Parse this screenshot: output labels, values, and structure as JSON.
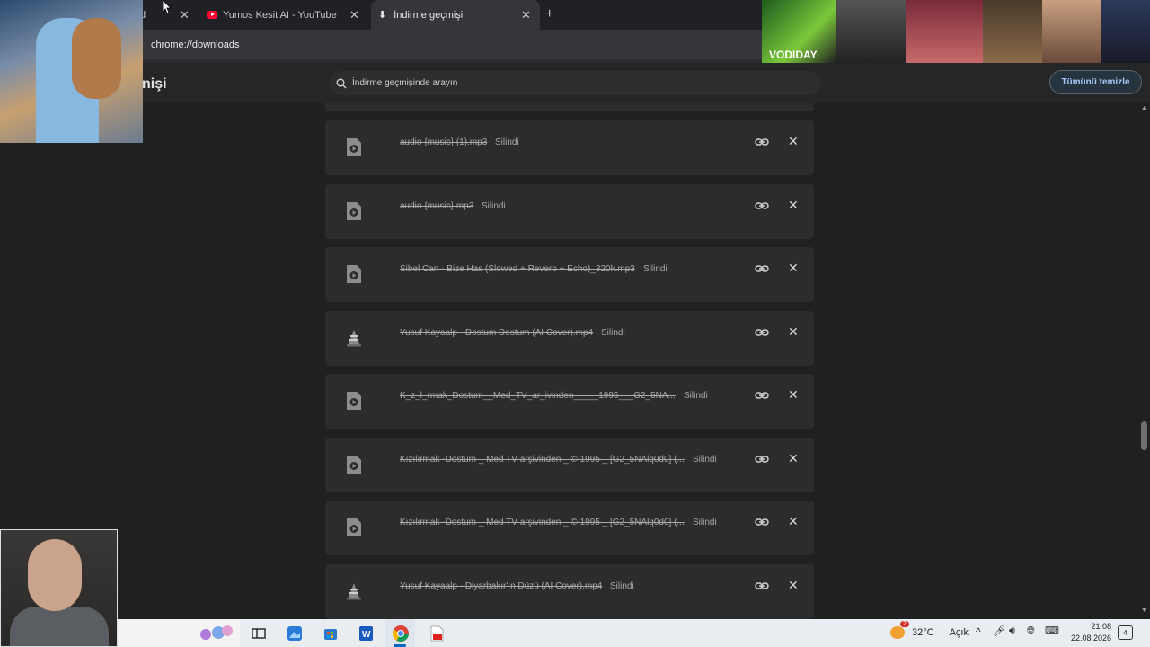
{
  "browser": {
    "tabs": [
      {
        "title": "d",
        "active": false
      },
      {
        "title": "Yumos Kesit AI - YouTube",
        "active": false
      },
      {
        "title": "İndirme geçmişi",
        "active": true
      }
    ],
    "url": "chrome://downloads"
  },
  "page": {
    "title": "nişi",
    "search_placeholder": "İndirme geçmişinde arayın",
    "clear_all_label": "Tümünü temizle"
  },
  "downloads": [
    {
      "name": "audio {music} (1).mp3",
      "status": "Silindi",
      "icon": "audio-file-icon"
    },
    {
      "name": "audio {music}.mp3",
      "status": "Silindi",
      "icon": "audio-file-icon"
    },
    {
      "name": "Sibel Can - Bize Has (Slowed + Reverb + Echo)_320k.mp3",
      "status": "Silindi",
      "icon": "audio-file-icon"
    },
    {
      "name": "Yusuf Kayaalp - Dostum Dostum (AI Cover).mp4",
      "status": "Silindi",
      "icon": "vlc-cone-icon"
    },
    {
      "name": "K_z_l_rmak_Dostum__Med_TV_ar_ivinden_____1995___G2_5NA...",
      "status": "Silindi",
      "icon": "audio-file-icon"
    },
    {
      "name": "Kızılırmak -Dostum _ Med TV arşivinden _ © 1995 _ [G2_5NAlq0d0] (...",
      "status": "Silindi",
      "icon": "audio-file-icon"
    },
    {
      "name": "Kızılırmak -Dostum _ Med TV arşivinden _ © 1995 _ [G2_5NAlq0d0] (...",
      "status": "Silindi",
      "icon": "audio-file-icon"
    },
    {
      "name": "Yusuf Kayaalp - Diyarbakır'ın Düzü (AI Cover).mp4",
      "status": "Silindi",
      "icon": "vlc-cone-icon"
    }
  ],
  "overlay": {
    "streamer_label": "VODIDAY"
  },
  "taskbar": {
    "weather_temp": "32°C",
    "weather_text": "Açık",
    "time": "21:08",
    "date": "22.08.2026",
    "notification_count": "4",
    "weather_badge": "2"
  },
  "colors": {
    "accent": "#a8c7fa",
    "card_bg": "#2b2c2d",
    "page_bg": "#1f2020"
  }
}
